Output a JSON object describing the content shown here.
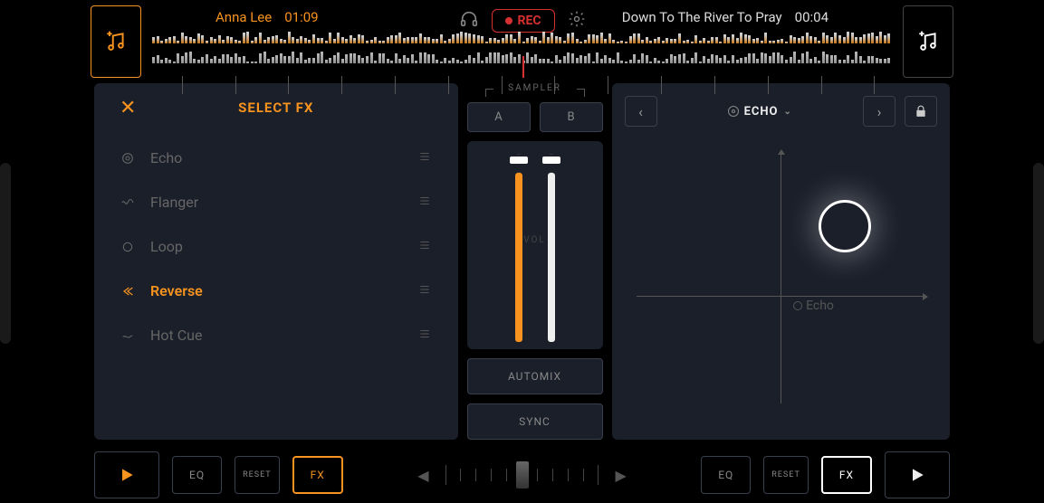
{
  "deck_a": {
    "track_title": "Anna Lee",
    "time": "01:09"
  },
  "deck_b": {
    "track_title": "Down To The River To Pray",
    "time": "00:04"
  },
  "recorder": {
    "label": "REC"
  },
  "fx_panel": {
    "title": "SELECT FX",
    "items": [
      {
        "label": "Echo",
        "active": false
      },
      {
        "label": "Flanger",
        "active": false
      },
      {
        "label": "Loop",
        "active": false
      },
      {
        "label": "Reverse",
        "active": true
      },
      {
        "label": "Hot Cue",
        "active": false
      }
    ]
  },
  "sampler": {
    "label": "SAMPLER",
    "buttons": {
      "a": "A",
      "b": "B"
    },
    "vol_label": "VOL"
  },
  "mixer": {
    "automix": "AUTOMIX",
    "sync": "SYNC"
  },
  "xy_panel": {
    "effect_name": "ECHO",
    "point_label": "Echo"
  },
  "bottom": {
    "eq": "EQ",
    "reset": "RESET",
    "fx": "FX"
  }
}
